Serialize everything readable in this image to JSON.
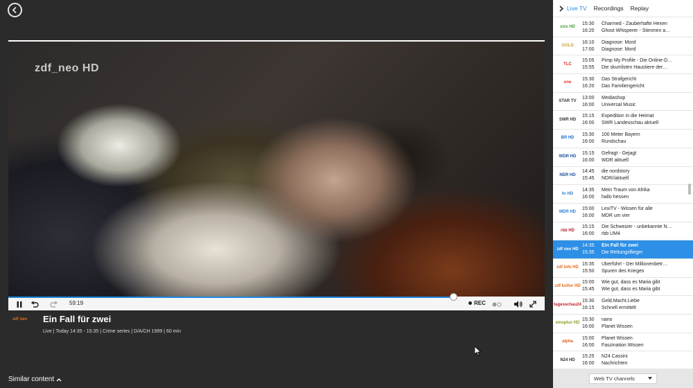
{
  "player": {
    "watermark": "zdf_neo HD",
    "current_time": "59:19",
    "progress_fraction": 0.83,
    "rec_label": "REC",
    "program_title": "Ein Fall für zwei",
    "program_meta": "Live | Today 14:35 - 15:35 | Crime series | D/A/CH 1999 | 60 min",
    "channel_logo_text": "zdf neo",
    "similar_label": "Similar content"
  },
  "sidebar": {
    "tabs": [
      {
        "label": "Live TV",
        "active": true
      },
      {
        "label": "Recordings",
        "active": false
      },
      {
        "label": "Replay",
        "active": false
      }
    ],
    "channels": [
      {
        "logo": "sixx HD",
        "logo_color": "#4aa23a",
        "t1": "15:30",
        "t2": "16:20",
        "p1": "Charmed - Zauberhafte Hexen",
        "p2": "Ghost Whisperer - Stimmen a…"
      },
      {
        "logo": "GOLD",
        "logo_color": "#c8a23a",
        "t1": "16:10",
        "t2": "17:00",
        "p1": "Diagnose: Mord",
        "p2": "Diagnose: Mord"
      },
      {
        "logo": "TLC",
        "logo_color": "#e02020",
        "t1": "15:05",
        "t2": "15:55",
        "p1": "Pimp My Profile - Die Online-D…",
        "p2": "Die skurrilsten Haustiere der…"
      },
      {
        "logo": "one",
        "logo_color": "#e03030",
        "t1": "15:30",
        "t2": "16:20",
        "p1": "Das Strafgericht",
        "p2": "Das Familiengericht"
      },
      {
        "logo": "STAR TV",
        "logo_color": "#333333",
        "t1": "13:00",
        "t2": "16:00",
        "p1": "Mediashop",
        "p2": "Universal Music"
      },
      {
        "logo": "SWR HD",
        "logo_color": "#333333",
        "t1": "15:15",
        "t2": "16:00",
        "p1": "Expedition in die Heimat",
        "p2": "SWR Landesschau aktuell"
      },
      {
        "logo": "BR HD",
        "logo_color": "#1f6fd0",
        "t1": "15:30",
        "t2": "16:00",
        "p1": "100 Meter Bayern",
        "p2": "Rundschau"
      },
      {
        "logo": "WDR HD",
        "logo_color": "#1f4fa0",
        "t1": "15:15",
        "t2": "16:00",
        "p1": "Gefragt - Gejagt",
        "p2": "WDR aktuell"
      },
      {
        "logo": "NDR HD",
        "logo_color": "#1f4fa0",
        "t1": "14:45",
        "t2": "15:45",
        "p1": "die nordstory",
        "p2": "NDR//aktuell"
      },
      {
        "logo": "hr HD",
        "logo_color": "#2a7fd0",
        "t1": "14:35",
        "t2": "16:00",
        "p1": "Mein Traum von Afrika",
        "p2": "hallo hessen"
      },
      {
        "logo": "MDR HD",
        "logo_color": "#2a7fd0",
        "t1": "15:00",
        "t2": "16:00",
        "p1": "LexiTV - Wissen für alle",
        "p2": "MDR um vier"
      },
      {
        "logo": "rbb HD",
        "logo_color": "#c02030",
        "t1": "15:15",
        "t2": "16:00",
        "p1": "Die Schweizer - unbekannte N…",
        "p2": "rbb UM4"
      },
      {
        "logo": "zdf neo HD",
        "logo_color": "#ffffff",
        "t1": "14:35",
        "t2": "15:35",
        "p1": "Ein Fall für zwei",
        "p2": "Die Rettungsflieger",
        "selected": true
      },
      {
        "logo": "zdf info HD",
        "logo_color": "#e36a1c",
        "t1": "15:35",
        "t2": "15:50",
        "p1": "Überführt - Der Millionenbetr…",
        "p2": "Spuren des Krieges"
      },
      {
        "logo": "zdf kultur HD",
        "logo_color": "#e36a1c",
        "t1": "15:00",
        "t2": "15:45",
        "p1": "Wie gut, dass es Maria gibt",
        "p2": "Wie gut, dass es Maria gibt"
      },
      {
        "logo": "tagesschau24",
        "logo_color": "#c02030",
        "t1": "15:30",
        "t2": "16:15",
        "p1": "Geld.Macht.Liebe",
        "p2": "Schnell ermittelt"
      },
      {
        "logo": "einsplus HD",
        "logo_color": "#8aa020",
        "t1": "15:30",
        "t2": "16:00",
        "p1": "nano",
        "p2": "Planet Wissen"
      },
      {
        "logo": "alpha",
        "logo_color": "#e05a10",
        "t1": "15:00",
        "t2": "16:00",
        "p1": "Planet Wissen",
        "p2": "Faszination Wissen"
      },
      {
        "logo": "N24 HD",
        "logo_color": "#333333",
        "t1": "15:25",
        "t2": "16:00",
        "p1": "N24 Cassini",
        "p2": "Nachrichten"
      }
    ],
    "dropdown_value": "Web TV channels"
  }
}
